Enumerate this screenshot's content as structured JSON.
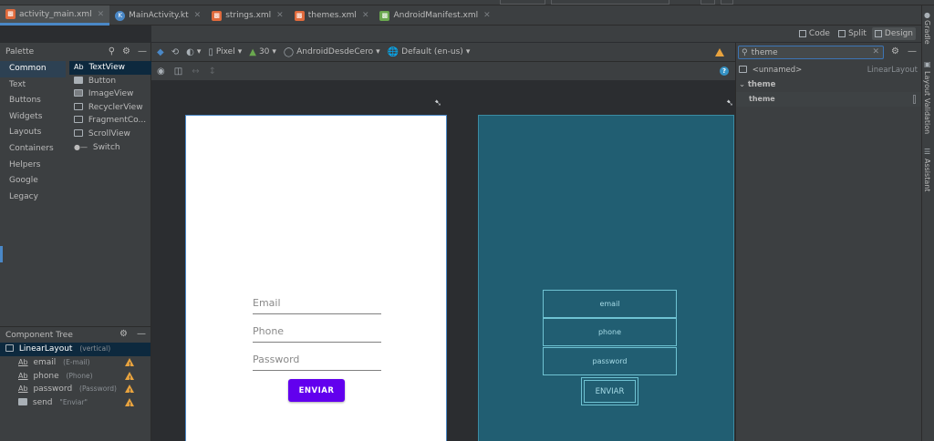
{
  "tabs": [
    {
      "label": "activity_main.xml",
      "icon": "xml-layout-icon",
      "color": "#e06a3c",
      "active": true
    },
    {
      "label": "MainActivity.kt",
      "icon": "kotlin-file-icon",
      "color": "#4a88c7",
      "active": false
    },
    {
      "label": "strings.xml",
      "icon": "xml-values-icon",
      "color": "#e06a3c",
      "active": false
    },
    {
      "label": "themes.xml",
      "icon": "xml-values-icon",
      "color": "#e06a3c",
      "active": false
    },
    {
      "label": "AndroidManifest.xml",
      "icon": "manifest-icon",
      "color": "#6aa84f",
      "active": false
    }
  ],
  "view_modes": {
    "code": "Code",
    "split": "Split",
    "design": "Design"
  },
  "palette": {
    "title": "Palette",
    "categories": [
      "Common",
      "Text",
      "Buttons",
      "Widgets",
      "Layouts",
      "Containers",
      "Helpers",
      "Google",
      "Legacy"
    ],
    "widgets": [
      {
        "label": "TextView",
        "prefix": "Ab"
      },
      {
        "label": "Button",
        "prefix": ""
      },
      {
        "label": "ImageView",
        "prefix": ""
      },
      {
        "label": "RecyclerView",
        "prefix": ""
      },
      {
        "label": "FragmentCo...",
        "prefix": ""
      },
      {
        "label": "ScrollView",
        "prefix": ""
      },
      {
        "label": "Switch",
        "prefix": ""
      }
    ]
  },
  "component_tree": {
    "title": "Component Tree",
    "root": {
      "name": "LinearLayout",
      "hint": "(vertical)"
    },
    "children": [
      {
        "name": "email",
        "hint": "(E-mail)",
        "prefix": "Ab"
      },
      {
        "name": "phone",
        "hint": "(Phone)",
        "prefix": "Ab"
      },
      {
        "name": "password",
        "hint": "(Password)",
        "prefix": "Ab"
      },
      {
        "name": "send",
        "hint": "\"Enviar\"",
        "prefix": ""
      }
    ]
  },
  "design_toolbar": {
    "device": "Pixel",
    "api": "30",
    "theme": "AndroidDesdeCero",
    "locale": "Default (en-us)"
  },
  "preview": {
    "email_hint": "Email",
    "phone_hint": "Phone",
    "password_hint": "Password",
    "button_label": "ENVIAR"
  },
  "blueprint": {
    "email": "email",
    "phone": "phone",
    "password": "password",
    "button": "ENVIAR"
  },
  "attributes": {
    "search_value": "theme",
    "component_name": "<unnamed>",
    "component_type": "LinearLayout",
    "section": "theme",
    "row_label": "theme"
  },
  "side_tools": [
    "Gradle",
    "Layout Validation",
    "Assistant"
  ]
}
